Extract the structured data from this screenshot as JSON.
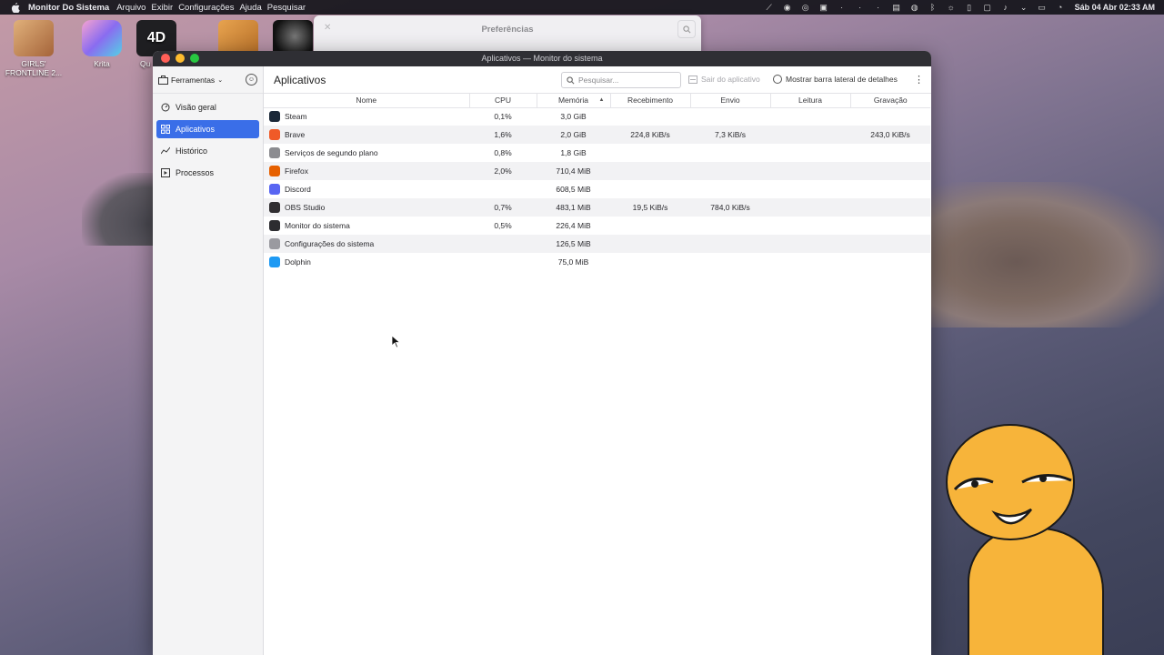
{
  "menubar": {
    "app_name": "Monitor Do Sistema",
    "menus": [
      "Arquivo",
      "Exibir",
      "Configurações",
      "Ajuda",
      "Pesquisar"
    ],
    "clock": "Sáb 04 Abr 02:33 AM"
  },
  "desktop_icons": [
    {
      "label": "GIRLS' FRONTLINE 2...",
      "color": "#c98a5a"
    },
    {
      "label": "Krita",
      "color": "#c66fd6"
    },
    {
      "label": "Qu",
      "color": "#2a2a2e"
    }
  ],
  "prefs_window": {
    "title": "Preferências"
  },
  "window": {
    "title": "Aplicativos — Monitor do sistema",
    "tools_label": "Ferramentas",
    "nav": [
      {
        "label": "Visão geral",
        "icon": "gauge-icon",
        "active": false
      },
      {
        "label": "Aplicativos",
        "icon": "grid-icon",
        "active": true
      },
      {
        "label": "Histórico",
        "icon": "chart-line-icon",
        "active": false
      },
      {
        "label": "Processos",
        "icon": "process-icon",
        "active": false
      }
    ],
    "page_title": "Aplicativos",
    "search_placeholder": "Pesquisar...",
    "exit_label": "Sair do aplicativo",
    "details_label": "Mostrar barra lateral de detalhes",
    "columns": [
      "Nome",
      "CPU",
      "Memória",
      "Recebimento",
      "Envio",
      "Leitura",
      "Gravação"
    ],
    "rows": [
      {
        "name": "Steam",
        "cpu": "0,1%",
        "mem": "3,0 GiB",
        "recv": "",
        "send": "",
        "read": "",
        "write": "",
        "icon_color": "#1b2838"
      },
      {
        "name": "Brave",
        "cpu": "1,6%",
        "mem": "2,0 GiB",
        "recv": "224,8 KiB/s",
        "send": "7,3 KiB/s",
        "read": "",
        "write": "243,0 KiB/s",
        "icon_color": "#f05a28"
      },
      {
        "name": "Serviços de segundo plano",
        "cpu": "0,8%",
        "mem": "1,8 GiB",
        "recv": "",
        "send": "",
        "read": "",
        "write": "",
        "icon_color": "#8c8c90"
      },
      {
        "name": "Firefox",
        "cpu": "2,0%",
        "mem": "710,4 MiB",
        "recv": "",
        "send": "",
        "read": "",
        "write": "",
        "icon_color": "#e66000"
      },
      {
        "name": "Discord",
        "cpu": "",
        "mem": "608,5 MiB",
        "recv": "",
        "send": "",
        "read": "",
        "write": "",
        "icon_color": "#5865f2"
      },
      {
        "name": "OBS Studio",
        "cpu": "0,7%",
        "mem": "483,1 MiB",
        "recv": "19,5 KiB/s",
        "send": "784,0 KiB/s",
        "read": "",
        "write": "",
        "icon_color": "#302e31"
      },
      {
        "name": "Monitor do sistema",
        "cpu": "0,5%",
        "mem": "226,4 MiB",
        "recv": "",
        "send": "",
        "read": "",
        "write": "",
        "icon_color": "#2c2c30"
      },
      {
        "name": "Configurações do sistema",
        "cpu": "",
        "mem": "126,5 MiB",
        "recv": "",
        "send": "",
        "read": "",
        "write": "",
        "icon_color": "#9a9aa0"
      },
      {
        "name": "Dolphin",
        "cpu": "",
        "mem": "75,0 MiB",
        "recv": "",
        "send": "",
        "read": "",
        "write": "",
        "icon_color": "#1d99f3"
      }
    ]
  }
}
